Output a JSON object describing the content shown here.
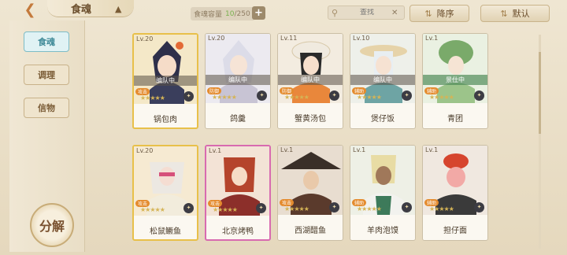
{
  "header": {
    "title": "食魂",
    "capacity_label": "食魂容量",
    "capacity_current": "10",
    "capacity_max": "/250",
    "search_placeholder": "查找",
    "sort_label": "降序",
    "default_label": "默认"
  },
  "sidebar": {
    "tabs": [
      {
        "label": "食魂",
        "active": true
      },
      {
        "label": "调理",
        "active": false
      },
      {
        "label": "信物",
        "active": false
      }
    ],
    "decompose_label": "分解"
  },
  "cards": [
    {
      "level": "Lv.20",
      "name": "锅包肉",
      "status": "编队中",
      "role": "攻击",
      "stars": "★★★★★",
      "frame": "gold"
    },
    {
      "level": "Lv.20",
      "name": "鸽羹",
      "status": "编队中",
      "role": "防御",
      "stars": "★★★★★",
      "frame": "normal"
    },
    {
      "level": "Lv.11",
      "name": "蟹黄汤包",
      "status": "编队中",
      "role": "防御",
      "stars": "★★★★★",
      "frame": "normal"
    },
    {
      "level": "Lv.10",
      "name": "煲仔饭",
      "status": "编队中",
      "role": "辅助",
      "stars": "★★★★★",
      "frame": "normal"
    },
    {
      "level": "Lv.1",
      "name": "青团",
      "status": "景仕中",
      "role": "辅助",
      "stars": "★★★★★",
      "frame": "normal"
    },
    {
      "level": "Lv.20",
      "name": "松鼠鳜鱼",
      "status": "",
      "role": "攻击",
      "stars": "★★★★★",
      "frame": "gold"
    },
    {
      "level": "Lv.1",
      "name": "北京烤鸭",
      "status": "",
      "role": "攻击",
      "stars": "★★★★★",
      "frame": "rainbow"
    },
    {
      "level": "Lv.1",
      "name": "西湖醋鱼",
      "status": "",
      "role": "攻击",
      "stars": "★★★★★",
      "frame": "normal"
    },
    {
      "level": "Lv.1",
      "name": "羊肉泡馍",
      "status": "",
      "role": "辅助",
      "stars": "★★★★★",
      "frame": "normal"
    },
    {
      "level": "Lv.1",
      "name": "担仔面",
      "status": "",
      "role": "辅助",
      "stars": "★★★★★",
      "frame": "normal"
    }
  ]
}
